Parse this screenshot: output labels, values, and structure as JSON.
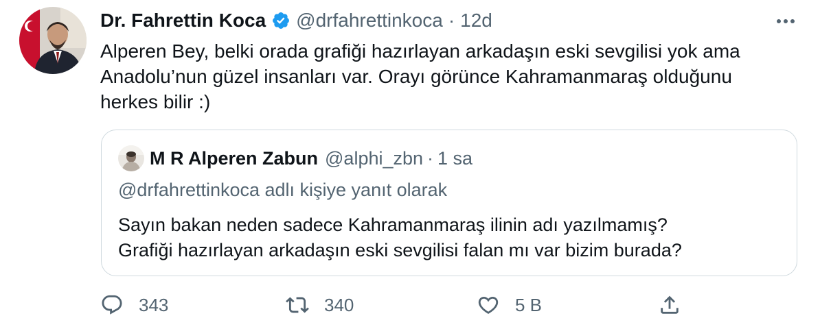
{
  "tweet": {
    "author_name": "Dr. Fahrettin Koca",
    "handle": "@drfahrettinkoca",
    "separator": "·",
    "time": "12d",
    "text_lines": [
      "Alperen Bey, belki orada grafiği hazırlayan arkadaşın eski sevgilisi yok ama",
      "Anadolu’nun güzel insanları var. Orayı görünce Kahramanmaraş olduğunu",
      "herkes bilir :)"
    ]
  },
  "quote": {
    "author_name": "M R Alperen Zabun",
    "handle": "@alphi_zbn",
    "separator": "·",
    "time": "1 sa",
    "reply_to": "@drfahrettinkoca adlı kişiye yanıt olarak",
    "text_lines": [
      "Sayın bakan neden sadece Kahramanmaraş ilinin adı yazılmamış?",
      "Grafiği hazırlayan arkadaşın eski sevgilisi falan mı var bizim burada?"
    ]
  },
  "actions": {
    "reply_count": "343",
    "retweet_count": "340",
    "like_count": "5 B"
  },
  "icons": {
    "verified": "verified-badge-icon",
    "more": "more-options-icon",
    "reply": "reply-icon",
    "retweet": "retweet-icon",
    "like": "like-icon",
    "share": "share-icon"
  },
  "colors": {
    "verified_blue": "#1d9bf0",
    "text_primary": "#0f1419",
    "text_secondary": "#536471",
    "border": "#cfd9de"
  }
}
